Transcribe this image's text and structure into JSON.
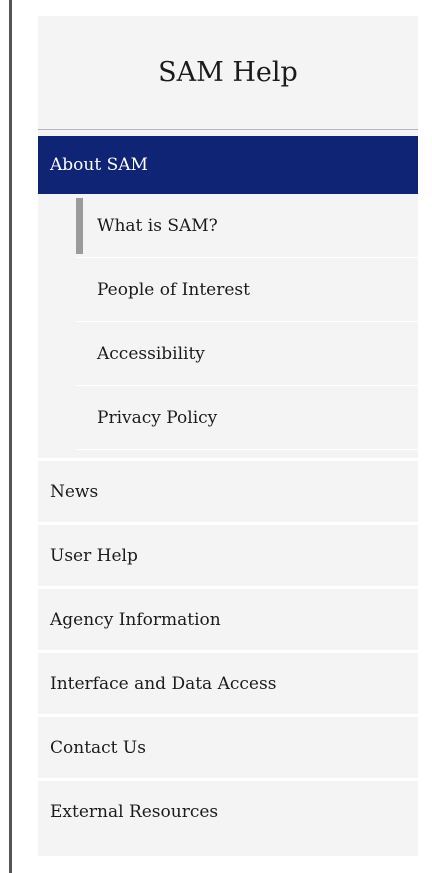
{
  "sidebar": {
    "title": "SAM Help",
    "active_section": {
      "label": "About SAM"
    },
    "sub_items": [
      {
        "label": "What is SAM?",
        "current": true
      },
      {
        "label": "People of Interest",
        "current": false
      },
      {
        "label": "Accessibility",
        "current": false
      },
      {
        "label": "Privacy Policy",
        "current": false
      }
    ],
    "items": [
      {
        "label": "News"
      },
      {
        "label": "User Help"
      },
      {
        "label": "Agency Information"
      },
      {
        "label": "Interface and Data Access"
      },
      {
        "label": "Contact Us"
      },
      {
        "label": "External Resources"
      }
    ]
  },
  "colors": {
    "active_bg": "#0f2474",
    "sidebar_bg": "#f4f4f4",
    "current_marker": "#9b9b9b"
  }
}
